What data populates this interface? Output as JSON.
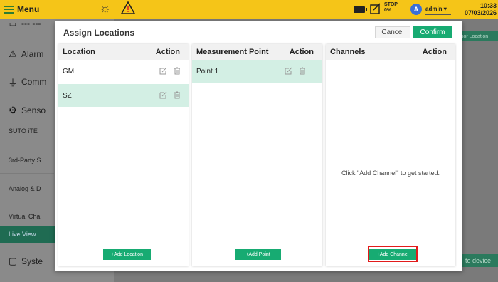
{
  "topbar": {
    "menu_label": "Menu",
    "stop_line1": "STOP",
    "stop_line2": "0%",
    "user_initial": "A",
    "user_name": "admin ▾",
    "time": "10:33",
    "date": "07/03/2026",
    "bar_color": "#f5c518"
  },
  "sidebar": {
    "partial_top": "--- ---",
    "alarms": "Alarm",
    "comm": "Comm",
    "sensors": "Senso",
    "suto": "SUTO iTE",
    "third_party": "3rd-Party S",
    "analog": "Analog & D",
    "virtual": "Virtual Cha",
    "live_view": "Live View",
    "system": "Syste"
  },
  "background": {
    "sensor_location": "sor Location",
    "to_device": "to device"
  },
  "dialog": {
    "title": "Assign Locations",
    "cancel_label": "Cancel",
    "confirm_label": "Confirm",
    "accent_color": "#17ab72",
    "locations": {
      "header_name": "Location",
      "header_action": "Action",
      "rows": [
        {
          "name": "GM",
          "selected": false
        },
        {
          "name": "SZ",
          "selected": true
        }
      ],
      "add_label": "+Add Location"
    },
    "measurement_points": {
      "header_name": "Measurement Point",
      "header_action": "Action",
      "rows": [
        {
          "name": "Point 1",
          "selected": true
        }
      ],
      "add_label": "+Add Point"
    },
    "channels": {
      "header_name": "Channels",
      "header_action": "Action",
      "empty_message": "Click \"Add Channel\" to get started.",
      "add_label": "+Add Channel"
    }
  },
  "icons": {
    "edit": "edit-icon",
    "delete": "trash-icon",
    "highlight_color": "#e21b1b"
  }
}
